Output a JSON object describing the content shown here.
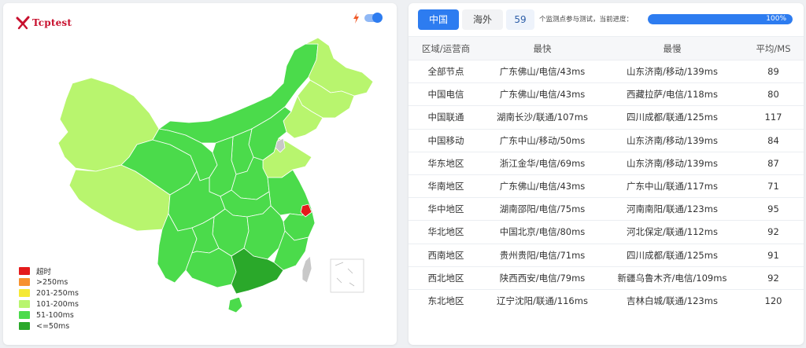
{
  "logo": {
    "text": "Tcptest"
  },
  "colors": {
    "timeout": "#e41a1c",
    "over250": "#f7922e",
    "r201_250": "#f5e935",
    "r101_200": "#b8f56e",
    "r51_100": "#4bdb4b",
    "le50": "#2aa82a",
    "accent": "#2d7cf0"
  },
  "legend": [
    {
      "label": "超时",
      "color": "#e41a1c"
    },
    {
      "label": ">250ms",
      "color": "#f7922e"
    },
    {
      "label": "201-250ms",
      "color": "#f5e935"
    },
    {
      "label": "101-200ms",
      "color": "#b8f56e"
    },
    {
      "label": "51-100ms",
      "color": "#4bdb4b"
    },
    {
      "label": "<=50ms",
      "color": "#2aa82a"
    }
  ],
  "tabs": [
    {
      "label": "中国",
      "active": true
    },
    {
      "label": "海外",
      "active": false
    }
  ],
  "monitor_count": "59",
  "monitor_text": "个监测点参与测试，当前进度：",
  "progress": {
    "value": 100,
    "label": "100%"
  },
  "table": {
    "headers": [
      "区域/运营商",
      "最快",
      "最慢",
      "平均/MS"
    ],
    "rows": [
      [
        "全部节点",
        "广东佛山/电信/43ms",
        "山东济南/移动/139ms",
        "89"
      ],
      [
        "中国电信",
        "广东佛山/电信/43ms",
        "西藏拉萨/电信/118ms",
        "80"
      ],
      [
        "中国联通",
        "湖南长沙/联通/107ms",
        "四川成都/联通/125ms",
        "117"
      ],
      [
        "中国移动",
        "广东中山/移动/50ms",
        "山东济南/移动/139ms",
        "84"
      ],
      [
        "华东地区",
        "浙江金华/电信/69ms",
        "山东济南/移动/139ms",
        "87"
      ],
      [
        "华南地区",
        "广东佛山/电信/43ms",
        "广东中山/联通/117ms",
        "71"
      ],
      [
        "华中地区",
        "湖南邵阳/电信/75ms",
        "河南南阳/联通/123ms",
        "95"
      ],
      [
        "华北地区",
        "中国北京/电信/80ms",
        "河北保定/联通/112ms",
        "92"
      ],
      [
        "西南地区",
        "贵州贵阳/电信/71ms",
        "四川成都/联通/125ms",
        "91"
      ],
      [
        "西北地区",
        "陕西西安/电信/79ms",
        "新疆乌鲁木齐/电信/109ms",
        "92"
      ],
      [
        "东北地区",
        "辽宁沈阳/联通/116ms",
        "吉林白城/联通/123ms",
        "120"
      ]
    ]
  }
}
